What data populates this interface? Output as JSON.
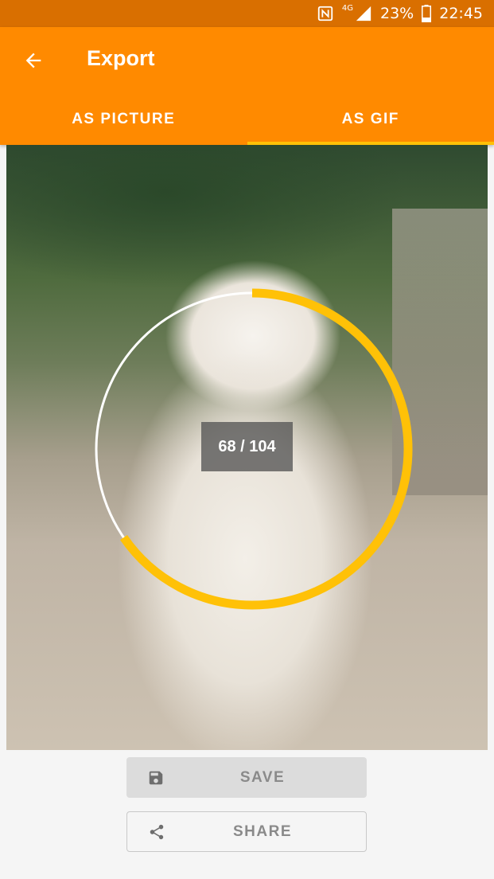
{
  "status_bar": {
    "network_type": "4G",
    "battery": "23%",
    "time": "22:45",
    "icons": [
      "nfc-icon",
      "signal-icon",
      "battery-icon"
    ]
  },
  "app_bar": {
    "title": "Export",
    "back_icon": "arrow-back-icon",
    "background_color": "#ff8a00"
  },
  "tabs": [
    {
      "label": "AS PICTURE",
      "selected": false
    },
    {
      "label": "AS GIF",
      "selected": true
    }
  ],
  "tab_indicator_color": "#ffc107",
  "photo": {
    "description_icon": "dog-photo"
  },
  "progress": {
    "current": 68,
    "total": 104,
    "text": "68 / 104",
    "color": "#ffc107",
    "track_color": "#ffffff"
  },
  "actions": {
    "save_label": "SAVE",
    "save_icon": "save-icon",
    "share_label": "SHARE",
    "share_icon": "share-icon"
  }
}
